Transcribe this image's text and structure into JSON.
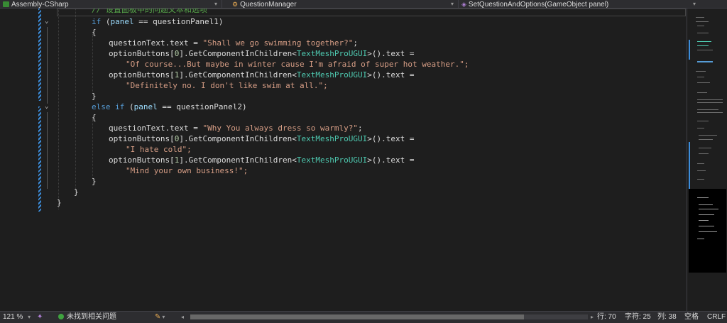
{
  "nav": {
    "project": "Assembly-CSharp",
    "class": "QuestionManager",
    "method": "SetQuestionAndOptions(GameObject panel)"
  },
  "code": {
    "comment": "// 设置面板中的问题文本和选项",
    "if1": {
      "kw": "if",
      "open": " (",
      "var": "panel",
      "op": " == questionPanel1)"
    },
    "brace_open": "{",
    "brace_close": "}",
    "q1": {
      "lead": "questionText.text = ",
      "str": "\"Shall we go swimming together?\"",
      "end": ";"
    },
    "o1a": {
      "lead": "optionButtons[",
      "idx": "0",
      "mid": "].GetComponentInChildren<",
      "typ": "TextMeshProUGUI",
      "tail": ">().text ="
    },
    "o1a_str": "\"Of course...But maybe in winter cause I'm afraid of super hot weather.\";",
    "o1b": {
      "lead": "optionButtons[",
      "idx": "1",
      "mid": "].GetComponentInChildren<",
      "typ": "TextMeshProUGUI",
      "tail": ">().text ="
    },
    "o1b_str": "\"Definitely no. I don't like swim at all.\";",
    "elseif": {
      "kw": "else if",
      "open": " (",
      "var": "panel",
      "op": " == questionPanel2)"
    },
    "q2": {
      "lead": "questionText.text = ",
      "str": "\"Why You always dress so warmly?\"",
      "end": ";"
    },
    "o2a": {
      "lead": "optionButtons[",
      "idx": "0",
      "mid": "].GetComponentInChildren<",
      "typ": "TextMeshProUGUI",
      "tail": ">().text ="
    },
    "o2a_str": "\"I hate cold\";",
    "o2b": {
      "lead": "optionButtons[",
      "idx": "1",
      "mid": "].GetComponentInChildren<",
      "typ": "TextMeshProUGUI",
      "tail": ">().text ="
    },
    "o2b_str": "\"Mind your own business!\";"
  },
  "status": {
    "zoom": "121 %",
    "issues": "未找到相关问题",
    "line": "行: 70",
    "char": "字符: 25",
    "col": "列: 38",
    "spaces": "空格",
    "eol": "CRLF"
  },
  "icons": {
    "fold": "chevron-down-icon",
    "ok": "check-circle-icon",
    "brush": "brush-icon",
    "copilot": "copilot-icon"
  },
  "colors": {
    "keyword": "#569cd6",
    "string": "#d69d85",
    "type": "#4ec9b0",
    "comment": "#57a64a",
    "change_marker": "#3c8ddb"
  }
}
